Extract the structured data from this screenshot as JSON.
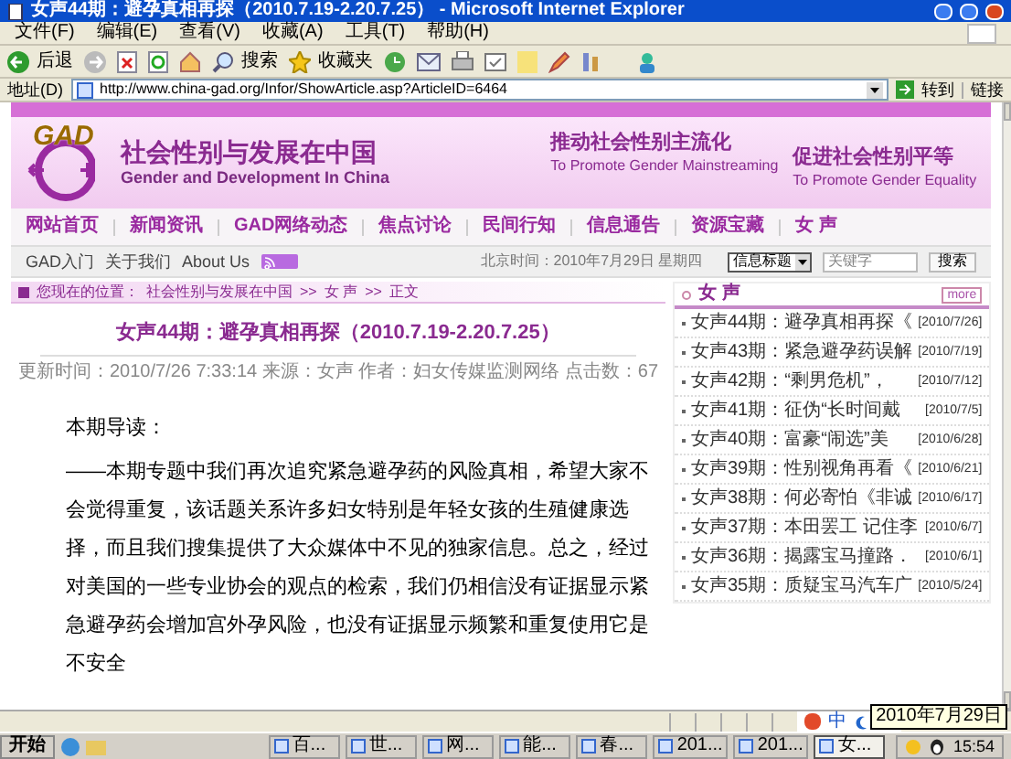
{
  "window": {
    "title": "女声44期：避孕真相再探（2010.7.19-2.20.7.25） - Microsoft Internet Explorer"
  },
  "menu": [
    "文件(F)",
    "编辑(E)",
    "查看(V)",
    "收藏(A)",
    "工具(T)",
    "帮助(H)"
  ],
  "toolbar": {
    "back": "后退",
    "search": "搜索",
    "favorites": "收藏夹"
  },
  "address": {
    "label": "地址(D)",
    "url": "http://www.china-gad.org/Infor/ShowArticle.asp?ArticleID=6464",
    "go": "转到",
    "links": "链接"
  },
  "banner": {
    "logo": "GAD",
    "name_cn": "社会性别与发展在中国",
    "name_en": "Gender and Development In China",
    "slogan1_cn": "推动社会性别主流化",
    "slogan1_en": "To Promote Gender Mainstreaming",
    "slogan2_cn": "促进社会性别平等",
    "slogan2_en": "To Promote Gender Equality"
  },
  "nav": [
    "网站首页",
    "新闻资讯",
    "GAD网络动态",
    "焦点讨论",
    "民间行知",
    "信息通告",
    "资源宝藏",
    "女 声"
  ],
  "subnav": {
    "links": [
      "GAD入门",
      "关于我们",
      "About Us"
    ],
    "date": "北京时间：2010年7月29日 星期四",
    "search_scope": "信息标题",
    "search_placeholder": "关键字",
    "search_button": "搜索"
  },
  "breadcrumb": {
    "label": "您现在的位置：",
    "path": [
      "社会性别与发展在中国",
      "女 声",
      "正文"
    ],
    "separator": ">>"
  },
  "article": {
    "title": "女声44期：避孕真相再探（2010.7.19-2.20.7.25）",
    "meta": "更新时间：2010/7/26 7:33:14 来源：女声 作者：妇女传媒监测网络 点击数：67",
    "intro": "本期导读：",
    "body": "——本期专题中我们再次追究紧急避孕药的风险真相，希望大家不会觉得重复，该话题关系许多妇女特别是年轻女孩的生殖健康选择，而且我们搜集提供了大众媒体中不见的独家信息。总之，经过对美国的一些专业协会的观点的检索，我们仍相信没有证据显示紧急避孕药会增加宫外孕风险，也没有证据显示频繁和重复使用它是不安全"
  },
  "sidebar": {
    "title": "女 声",
    "more": "more",
    "items": [
      {
        "title": "女声44期：避孕真相再探《",
        "date": "[2010/7/26]"
      },
      {
        "title": "女声43期：紧急避孕药误解",
        "date": "[2010/7/19]"
      },
      {
        "title": "女声42期：“剩男危机”，",
        "date": "[2010/7/12]"
      },
      {
        "title": "女声41期：征伪“长时间戴",
        "date": "[2010/7/5]"
      },
      {
        "title": "女声40期：富豪“闹选”美",
        "date": "[2010/6/28]"
      },
      {
        "title": "女声39期：性别视角再看《",
        "date": "[2010/6/21]"
      },
      {
        "title": "女声38期：何必寄怕《非诚",
        "date": "[2010/6/17]"
      },
      {
        "title": "女声37期：本田罢工 记住李",
        "date": "[2010/6/7]"
      },
      {
        "title": "女声36期：揭露宝马撞路．",
        "date": "[2010/6/1]"
      },
      {
        "title": "女声35期：质疑宝马汽车广",
        "date": "[2010/5/24]"
      }
    ]
  },
  "ime": "中",
  "taskbar": {
    "start": "开始",
    "tasks": [
      {
        "label": "百...",
        "selected": false
      },
      {
        "label": "世...",
        "selected": false
      },
      {
        "label": "网...",
        "selected": false
      },
      {
        "label": "能...",
        "selected": false
      },
      {
        "label": "春...",
        "selected": false
      },
      {
        "label": "201...",
        "selected": false
      },
      {
        "label": "201...",
        "selected": false
      },
      {
        "label": "女...",
        "selected": true
      }
    ],
    "clock": "15:54",
    "tooltip": "2010年7月29日"
  }
}
